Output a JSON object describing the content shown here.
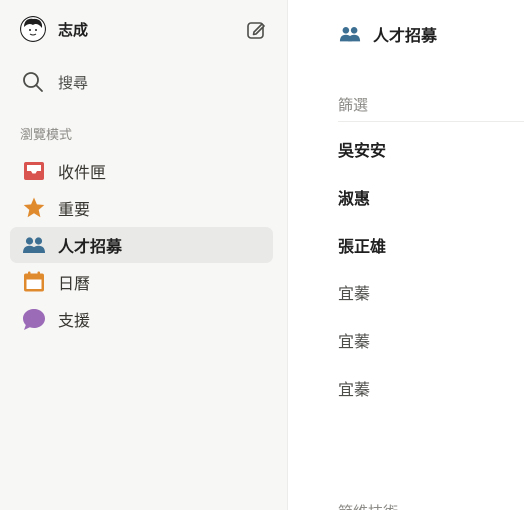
{
  "account": {
    "name": "志成"
  },
  "sidebar": {
    "search_label": "搜尋",
    "section_title": "瀏覽模式",
    "items": [
      {
        "label": "收件匣",
        "icon": "inbox-icon",
        "color": "#d9534f",
        "active": false
      },
      {
        "label": "重要",
        "icon": "star-icon",
        "color": "#e08a2e",
        "active": false
      },
      {
        "label": "人才招募",
        "icon": "people-icon",
        "color": "#3d6f93",
        "active": true
      },
      {
        "label": "日曆",
        "icon": "calendar-icon",
        "color": "#e08a2e",
        "active": false
      },
      {
        "label": "支援",
        "icon": "chat-bubble-icon",
        "color": "#9b6bb8",
        "active": false
      }
    ]
  },
  "main": {
    "title": "人才招募",
    "filter_label": "篩選",
    "people": [
      {
        "name": "吳安安",
        "bold": true
      },
      {
        "name": "淑惠",
        "bold": true
      },
      {
        "name": "張正雄",
        "bold": true
      },
      {
        "name": "宜蓁",
        "bold": false
      },
      {
        "name": "宜蓁",
        "bold": false
      },
      {
        "name": "宜蓁",
        "bold": false
      }
    ],
    "cut_text": "節維技術"
  }
}
